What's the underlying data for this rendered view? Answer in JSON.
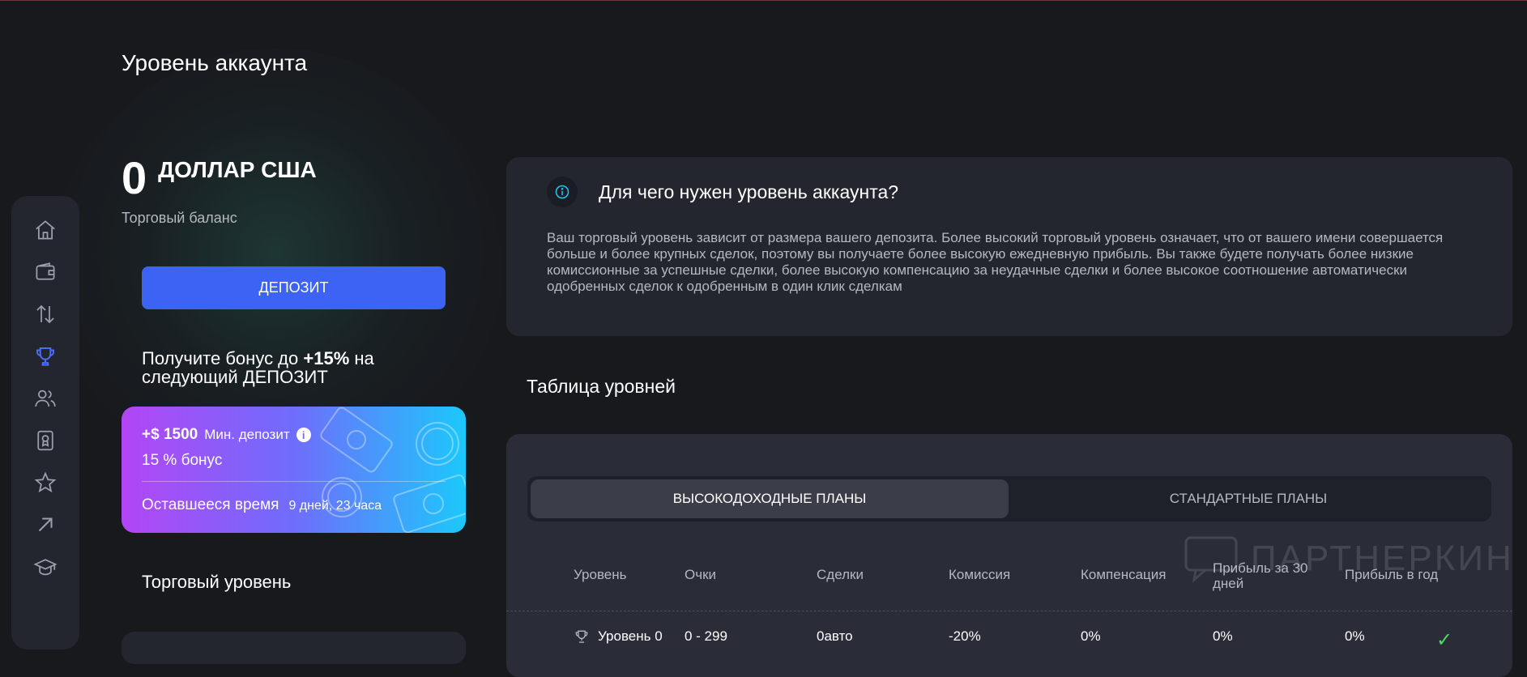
{
  "page": {
    "title": "Уровень аккаунта"
  },
  "sidebar": {
    "items": [
      {
        "icon": "home-icon"
      },
      {
        "icon": "wallet-icon"
      },
      {
        "icon": "transfer-icon"
      },
      {
        "icon": "trophy-icon",
        "active": true
      },
      {
        "icon": "users-icon"
      },
      {
        "icon": "certificate-icon"
      },
      {
        "icon": "star-icon"
      },
      {
        "icon": "arrow-up-right-icon"
      },
      {
        "icon": "graduation-cap-icon"
      }
    ]
  },
  "balance": {
    "amount": "0",
    "currency": "ДОЛЛАР США",
    "label": "Торговый баланс"
  },
  "deposit_button": "ДЕПОЗИТ",
  "bonus": {
    "heading_prefix": "Получите бонус до ",
    "heading_highlight": "+15%",
    "heading_suffix": " на следующий ДЕПОЗИТ",
    "amount": "+$ 1500",
    "min_deposit_label": "Мин. депозит",
    "percent_label": "15 % бонус",
    "time_left_label": "Оставшееся время",
    "time_left_value": "9 дней, 23 часа"
  },
  "trade_level_title": "Торговый уровень",
  "info": {
    "heading": "Для чего нужен уровень аккаунта?",
    "text": "Ваш торговый уровень зависит от размера вашего депозита. Более высокий торговый уровень означает, что от вашего имени совершается больше и более крупных сделок, поэтому вы получаете более высокую ежедневную прибыль. Вы также будете получать более низкие комиссионные за успешные сделки, более высокую компенсацию за неудачные сделки и более высокое соотношение автоматически одобренных сделок к одобренным в один клик сделкам"
  },
  "levels": {
    "title": "Таблица уровней",
    "tabs": [
      "ВЫСОКОДОХОДНЫЕ ПЛАНЫ",
      "СТАНДАРТНЫЕ ПЛАНЫ"
    ],
    "columns": [
      "Уровень",
      "Очки",
      "Сделки",
      "Комиссия",
      "Компенсация",
      "Прибыль за 30 дней",
      "Прибыль в год"
    ],
    "rows": [
      {
        "level": "Уровень 0",
        "points": "0 - 299",
        "trades": "0авто",
        "commission": "-20%",
        "compensation": "0%",
        "profit30": "0%",
        "profit_year": "0%"
      }
    ]
  },
  "watermark": "ПАРТНЕРКИН",
  "colors": {
    "accent": "#3d63f5",
    "card": "#24262f",
    "background": "#18191d",
    "check": "#4bd964"
  }
}
